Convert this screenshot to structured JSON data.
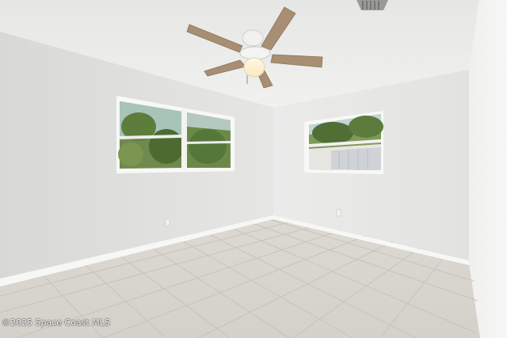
{
  "photo": {
    "subject": "empty-room-interior",
    "watermark": "©2025 Space Coast MLS"
  }
}
